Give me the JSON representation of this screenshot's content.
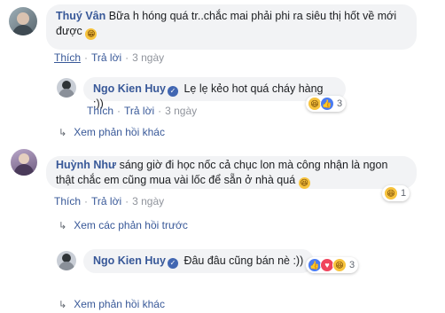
{
  "comments": [
    {
      "author": "Thuý Vân",
      "text": "Bữa h hóng quá tr..chắc mai phải phi ra siêu thị hốt về mới được",
      "emoji": "😁",
      "actions": {
        "like": "Thích",
        "reply": "Trả lời",
        "time": "3 ngày"
      },
      "reply": {
        "author": "Ngo Kien Huy",
        "text": "Lẹ lẹ kẻo hot quá cháy hàng :))",
        "actions": {
          "like": "Thích",
          "reply": "Trả lời",
          "time": "3 ngày"
        },
        "reaction_count": "3"
      },
      "more_replies": "Xem phản hồi khác"
    },
    {
      "author": "Huỳnh Như",
      "text": "sáng giờ đi học nốc cả chục lon mà công nhận là ngon thật chắc em cũng mua vài lốc để sẵn ở nhà quá",
      "emoji": "😆",
      "actions": {
        "like": "Thích",
        "reply": "Trả lời",
        "time": "3 ngày"
      },
      "reaction_count": "1",
      "previous_replies": "Xem các phản hồi trước",
      "reply": {
        "author": "Ngo Kien Huy",
        "text": "Đâu đâu cũng bán nè :))",
        "reaction_count": "3"
      },
      "more_replies": "Xem phản hồi khác"
    }
  ],
  "colors": {
    "link": "#385898",
    "bubble": "#f2f3f5",
    "meta": "#90949c",
    "verified": "#4267b2"
  },
  "icons": [
    "verified-icon",
    "haha-icon",
    "like-icon",
    "love-icon",
    "reply-arrow-icon"
  ]
}
